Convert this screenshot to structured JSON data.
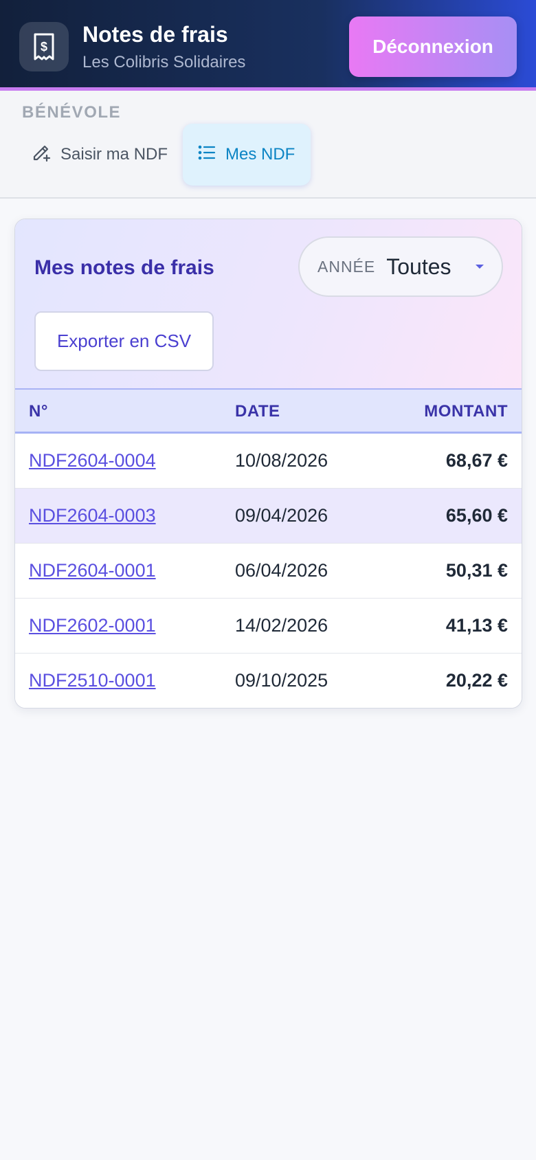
{
  "header": {
    "title": "Notes de frais",
    "subtitle": "Les Colibris Solidaires",
    "logout_label": "Déconnexion",
    "icon": "receipt-dollar-icon"
  },
  "nav": {
    "section_label": "BÉNÉVOLE",
    "tabs": [
      {
        "label": "Saisir ma NDF",
        "icon": "pencil-plus-icon",
        "active": false
      },
      {
        "label": "Mes NDF",
        "icon": "list-icon",
        "active": true
      }
    ]
  },
  "card": {
    "title": "Mes notes de frais",
    "year_filter": {
      "label": "ANNÉE",
      "value": "Toutes"
    },
    "export_label": "Exporter en CSV"
  },
  "table": {
    "columns": [
      "N°",
      "DATE",
      "MONTANT"
    ],
    "rows": [
      {
        "number": "NDF2604-0004",
        "date": "10/08/2026",
        "amount": "68,67 €"
      },
      {
        "number": "NDF2604-0003",
        "date": "09/04/2026",
        "amount": "65,60 €"
      },
      {
        "number": "NDF2604-0001",
        "date": "06/04/2026",
        "amount": "50,31 €"
      },
      {
        "number": "NDF2602-0001",
        "date": "14/02/2026",
        "amount": "41,13 €"
      },
      {
        "number": "NDF2510-0001",
        "date": "09/10/2025",
        "amount": "20,22 €"
      }
    ]
  },
  "colors": {
    "accent": "#4a3fd0",
    "active_tab": "#0b84c4",
    "logout_gradient_start": "#e979f4",
    "logout_gradient_end": "#a68ff4"
  }
}
